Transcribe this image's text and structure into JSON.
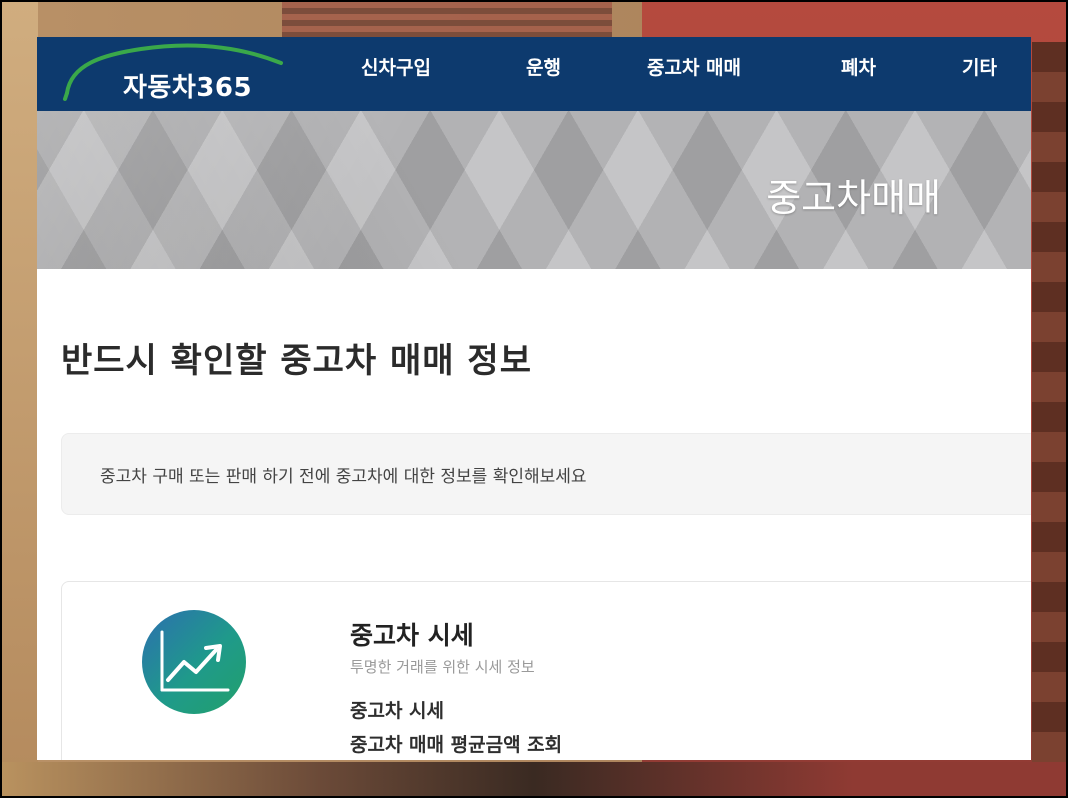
{
  "brand": {
    "name": "자동차365"
  },
  "nav": {
    "items": [
      {
        "label": "신차구입"
      },
      {
        "label": "운행"
      },
      {
        "label": "중고차 매매"
      },
      {
        "label": "폐차"
      },
      {
        "label": "기타"
      }
    ]
  },
  "hero": {
    "title": "중고차매매"
  },
  "main": {
    "title": "반드시 확인할 중고차 매매 정보",
    "notice": "중고차 구매 또는 판매 하기 전에 중고차에 대한 정보를 확인해보세요"
  },
  "card": {
    "icon": "trend-chart-icon",
    "title": "중고차 시세",
    "subtitle": "투명한 거래를 위한 시세 정보",
    "links": [
      {
        "label": "중고차 시세"
      },
      {
        "label": "중고차 매매 평균금액 조회"
      }
    ]
  },
  "colors": {
    "nav_bg": "#0d3a6e",
    "logo_arc": "#3aa84a",
    "icon_gradient_start": "#2c6fb0",
    "icon_gradient_end": "#22a06b"
  }
}
